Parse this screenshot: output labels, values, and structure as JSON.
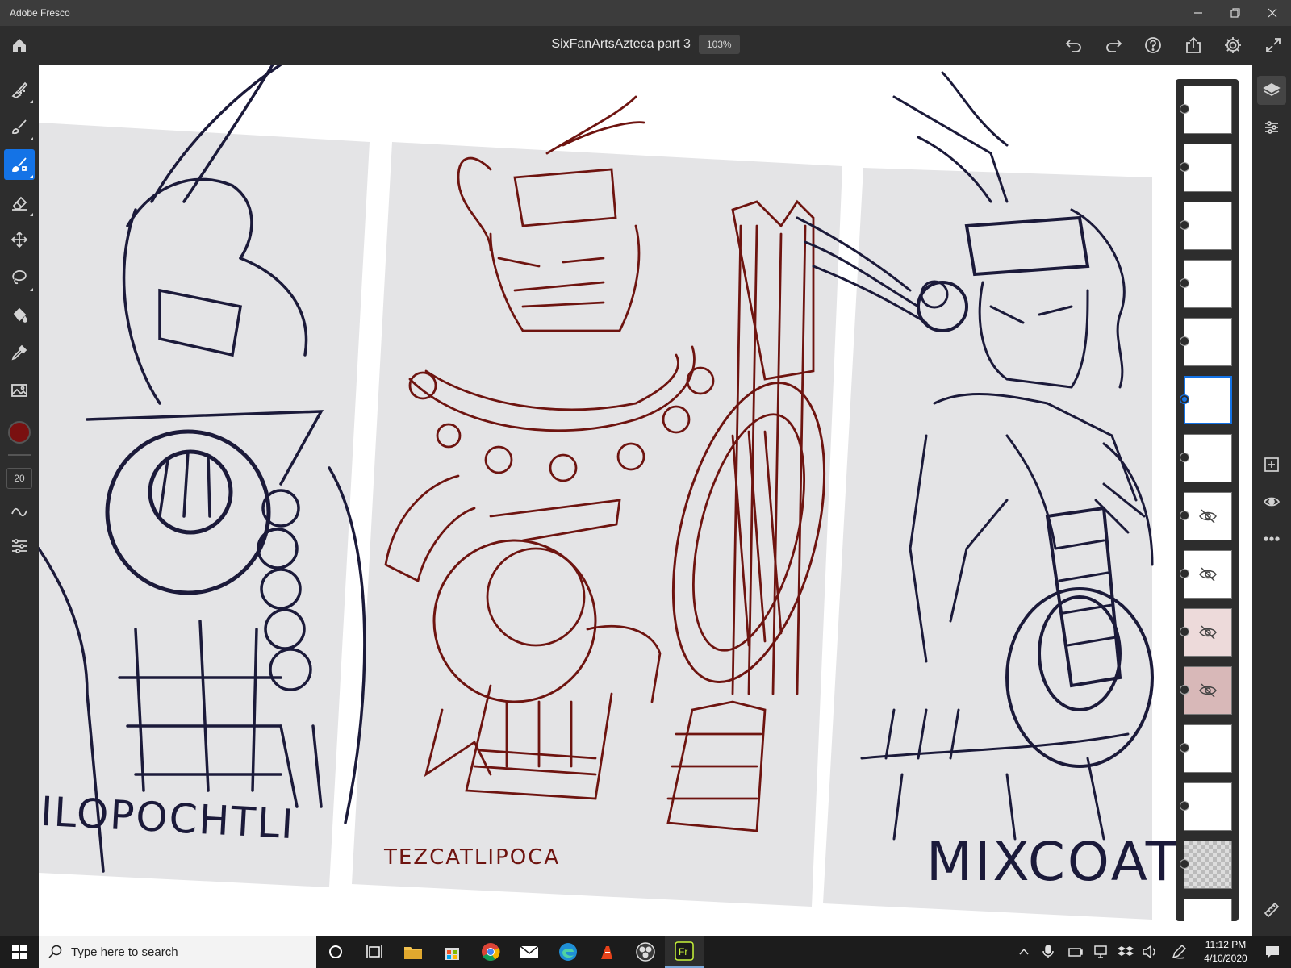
{
  "window": {
    "app_name": "Adobe Fresco"
  },
  "appbar": {
    "document_title": "SixFanArtsAzteca part 3",
    "zoom": "103%"
  },
  "left_toolbar": {
    "tools": [
      "pixel-brush-icon",
      "live-brush-icon",
      "vector-brush-icon",
      "eraser-icon",
      "move-transform-icon",
      "lasso-select-icon",
      "fill-icon",
      "eyedropper-icon",
      "image-icon"
    ],
    "active_tool": "vector-brush-icon",
    "color": "#7a1010",
    "brush_size": "20"
  },
  "canvas": {
    "panel_labels": [
      "ILOPOCHTLI",
      "TEZCATLIPOCA",
      "MIXCOAT"
    ]
  },
  "layers": {
    "count": 15,
    "selected_index": 5,
    "hidden_indices": [
      7,
      8,
      9,
      10
    ]
  },
  "right_strip": {
    "items": [
      "layers-icon",
      "properties-icon",
      "add-layer-icon",
      "visibility-icon",
      "more-icon",
      "ruler-icon"
    ]
  },
  "taskbar": {
    "search_placeholder": "Type here to search",
    "time": "11:12 PM",
    "date": "4/10/2020"
  },
  "colors": {
    "accent": "#1473e6",
    "ink_dark": "#1b1a3a",
    "ink_red": "#6e1410",
    "panel_gray": "#e4e4e6"
  }
}
